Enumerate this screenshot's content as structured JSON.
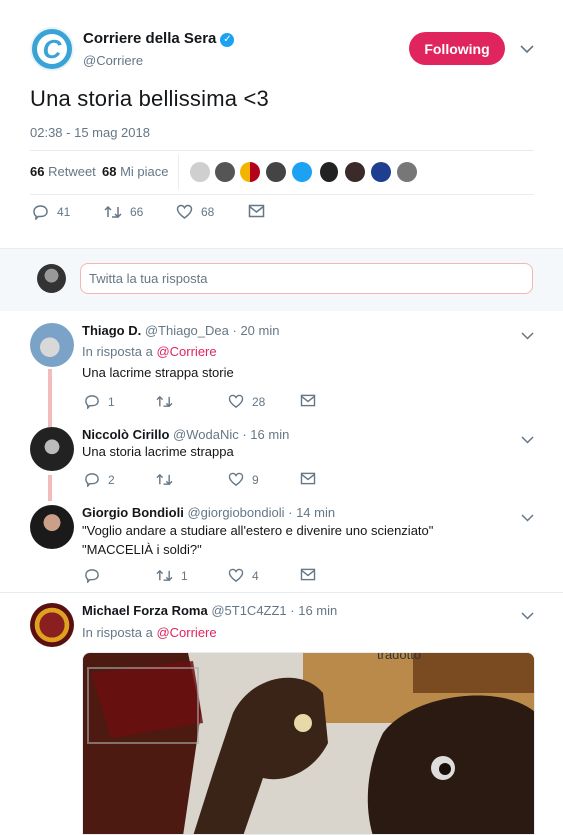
{
  "tweet": {
    "author_name": "Corriere della Sera",
    "author_handle": "@Corriere",
    "follow_label": "Following",
    "text": "Una storia bellissima <3",
    "timestamp": "02:38 - 15 mag 2018",
    "retweets_count": "66",
    "retweets_label": "Retweet",
    "likes_count": "68",
    "likes_label": "Mi piace",
    "actions": {
      "replies": "41",
      "retweets": "66",
      "likes": "68"
    }
  },
  "reply_box": {
    "placeholder": "Twitta la tua risposta"
  },
  "replies": [
    {
      "name": "Thiago D.",
      "handle": "@Thiago_Dea",
      "time": "· 20 min",
      "in_reply_prefix": "In risposta a",
      "in_reply_to": "@Corriere",
      "text": "Una lacrime strappa storie",
      "replies": "1",
      "retweets": "",
      "likes": "28"
    },
    {
      "name": "Niccolò Cirillo",
      "handle": "@WodaNic",
      "time": "· 16 min",
      "text": "Una storia lacrime strappa",
      "replies": "2",
      "retweets": "",
      "likes": "9"
    },
    {
      "name": "Giorgio Bondioli",
      "handle": "@giorgiobondioli",
      "time": "· 14 min",
      "text_line1": "\"Voglio andare a studiare all'estero e divenire uno scienziato\"",
      "text_line2": "\"MACCELIÀ i soldi?\"",
      "replies": "",
      "retweets": "1",
      "likes": "4"
    },
    {
      "name": "Michael Forza Roma",
      "handle": "@5T1C4ZZ1",
      "time": "· 16 min",
      "in_reply_prefix": "In risposta a",
      "in_reply_to": "@Corriere",
      "media_caption": "tradotto"
    }
  ],
  "colors": {
    "brand_blue": "#1da1f2",
    "following_red": "#e0245e",
    "thread_line": "#f2bcbc",
    "corriere_logo": "#3aa3d6"
  }
}
